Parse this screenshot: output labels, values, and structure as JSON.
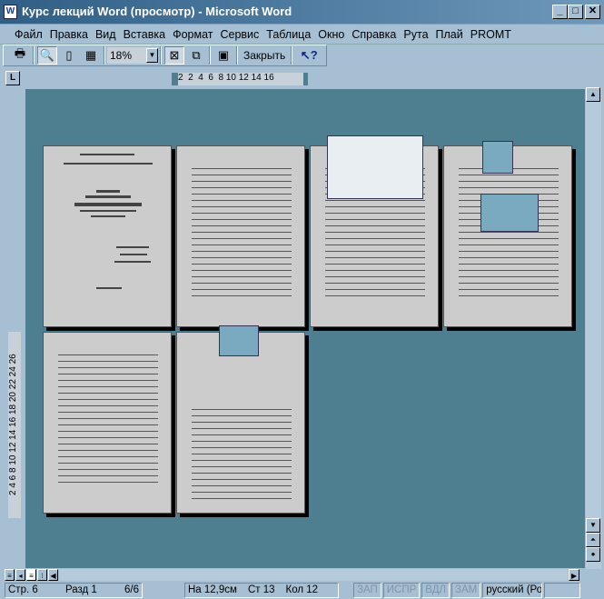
{
  "window": {
    "title": "Курс лекций Word (просмотр) - Microsoft Word",
    "app_icon": "W"
  },
  "menu": [
    "Файл",
    "Правка",
    "Вид",
    "Вставка",
    "Формат",
    "Сервис",
    "Таблица",
    "Окно",
    "Справка",
    "Рута",
    "Плай",
    "PROMT"
  ],
  "toolbar": {
    "zoom": "18%",
    "close_label": "Закрыть"
  },
  "ruler": {
    "horizontal": "2  2  4  6  8 10 12 14 16",
    "vertical": "2 4 6 8 10 12 14 16 18 20 22 24 26",
    "tab_stop": "L"
  },
  "status": {
    "page": "Стр. 6",
    "section": "Разд 1",
    "pages": "6/6",
    "at": "На 12,9см",
    "line": "Ст 13",
    "col": "Кол 12",
    "rec": "ЗАП",
    "trk": "ИСПР",
    "ext": "ВДЛ",
    "ovr": "ЗАМ",
    "lang": "русский (Ро"
  },
  "document": {
    "page_count": 6
  }
}
